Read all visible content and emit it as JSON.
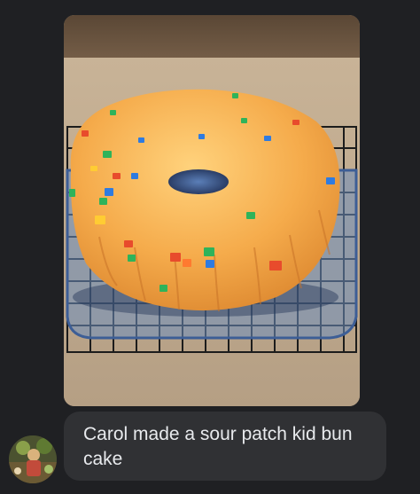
{
  "conversation": {
    "image_message": {
      "alt_label": "cake-photo"
    },
    "text_message": {
      "text": "Carol made a sour patch kid bun cake"
    },
    "sender": {
      "avatar_icon": "profile-photo-icon"
    }
  },
  "colors": {
    "background": "#1f2023",
    "bubble": "#303134",
    "bubble_text": "#e8eaed",
    "cake": "#f2a94b"
  }
}
